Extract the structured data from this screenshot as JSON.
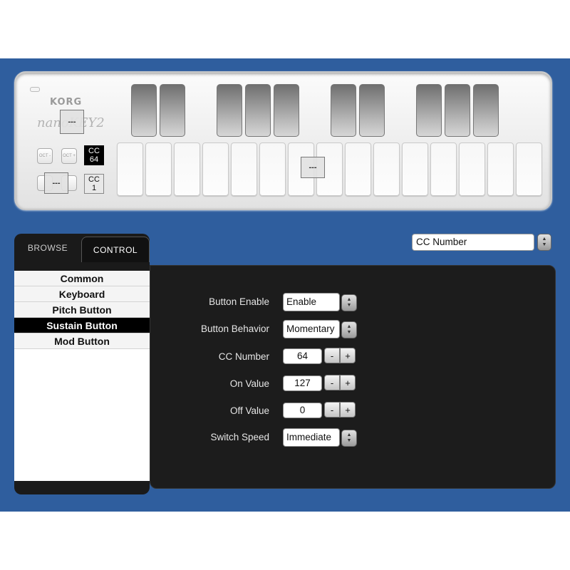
{
  "device": {
    "brand": "KORG",
    "model": "nanoKEY2",
    "marker_label": "---",
    "octave_down": "OCT -",
    "octave_up": "OCT +",
    "cc_sustain": {
      "line1": "CC",
      "line2": "64"
    },
    "cc_mod": {
      "line1": "CC",
      "line2": "1"
    }
  },
  "tabs": [
    {
      "label": "BROWSE"
    },
    {
      "label": "CONTROL"
    }
  ],
  "sidebar": {
    "items": [
      {
        "label": "Common"
      },
      {
        "label": "Keyboard"
      },
      {
        "label": "Pitch Button"
      },
      {
        "label": "Sustain Button"
      },
      {
        "label": "Mod Button"
      }
    ],
    "selected": "Sustain Button"
  },
  "header": {
    "dropdown_value": "CC Number"
  },
  "settings": {
    "button_enable": {
      "label": "Button Enable",
      "value": "Enable"
    },
    "button_behavior": {
      "label": "Button Behavior",
      "value": "Momentary"
    },
    "cc_number": {
      "label": "CC Number",
      "value": "64"
    },
    "on_value": {
      "label": "On Value",
      "value": "127"
    },
    "off_value": {
      "label": "Off Value",
      "value": "0"
    },
    "switch_speed": {
      "label": "Switch Speed",
      "value": "Immediate"
    },
    "minus": "-",
    "plus": "+"
  },
  "colors": {
    "background": "#2f5e9e",
    "panel": "#1c1c1c",
    "selected_item": "#000000"
  }
}
